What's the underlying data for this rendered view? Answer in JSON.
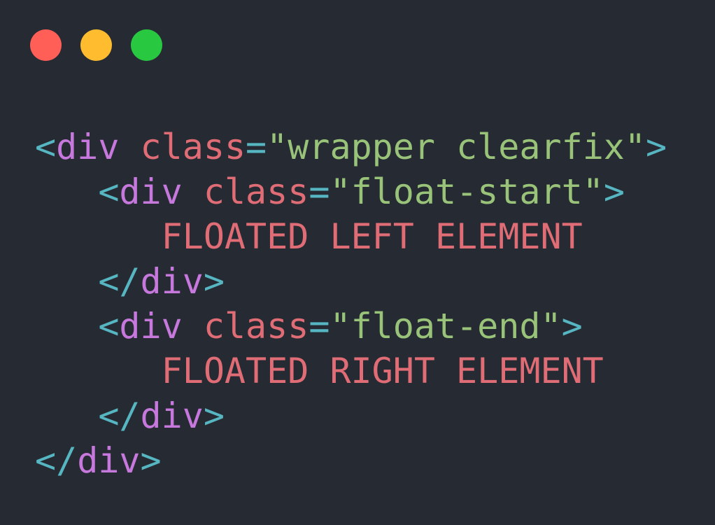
{
  "window_controls": {
    "close_color": "#ff5f57",
    "minimize_color": "#febc2e",
    "zoom_color": "#28c840"
  },
  "colors": {
    "background": "#262a33",
    "punctuation": "#56b6c2",
    "tag": "#c678dd",
    "attribute": "#e06c75",
    "string": "#98c379",
    "text": "#e06c75"
  },
  "code": {
    "lines": [
      [
        {
          "type": "punct",
          "text": "<"
        },
        {
          "type": "tag",
          "text": "div"
        },
        {
          "type": "space",
          "text": " "
        },
        {
          "type": "attr",
          "text": "class"
        },
        {
          "type": "punct",
          "text": "="
        },
        {
          "type": "string",
          "text": "\"wrapper clearfix\""
        },
        {
          "type": "punct",
          "text": ">"
        }
      ],
      [
        {
          "type": "indent",
          "text": "   "
        },
        {
          "type": "punct",
          "text": "<"
        },
        {
          "type": "tag",
          "text": "div"
        },
        {
          "type": "space",
          "text": " "
        },
        {
          "type": "attr",
          "text": "class"
        },
        {
          "type": "punct",
          "text": "="
        },
        {
          "type": "string",
          "text": "\"float-start\""
        },
        {
          "type": "punct",
          "text": ">"
        }
      ],
      [
        {
          "type": "indent",
          "text": "      "
        },
        {
          "type": "text",
          "text": "FLOATED LEFT ELEMENT"
        }
      ],
      [
        {
          "type": "indent",
          "text": "   "
        },
        {
          "type": "punct",
          "text": "</"
        },
        {
          "type": "tag",
          "text": "div"
        },
        {
          "type": "punct",
          "text": ">"
        }
      ],
      [
        {
          "type": "indent",
          "text": "   "
        },
        {
          "type": "punct",
          "text": "<"
        },
        {
          "type": "tag",
          "text": "div"
        },
        {
          "type": "space",
          "text": " "
        },
        {
          "type": "attr",
          "text": "class"
        },
        {
          "type": "punct",
          "text": "="
        },
        {
          "type": "string",
          "text": "\"float-end\""
        },
        {
          "type": "punct",
          "text": ">"
        }
      ],
      [
        {
          "type": "indent",
          "text": "      "
        },
        {
          "type": "text",
          "text": "FLOATED RIGHT ELEMENT"
        }
      ],
      [
        {
          "type": "indent",
          "text": "   "
        },
        {
          "type": "punct",
          "text": "</"
        },
        {
          "type": "tag",
          "text": "div"
        },
        {
          "type": "punct",
          "text": ">"
        }
      ],
      [
        {
          "type": "punct",
          "text": "</"
        },
        {
          "type": "tag",
          "text": "div"
        },
        {
          "type": "punct",
          "text": ">"
        }
      ]
    ]
  }
}
